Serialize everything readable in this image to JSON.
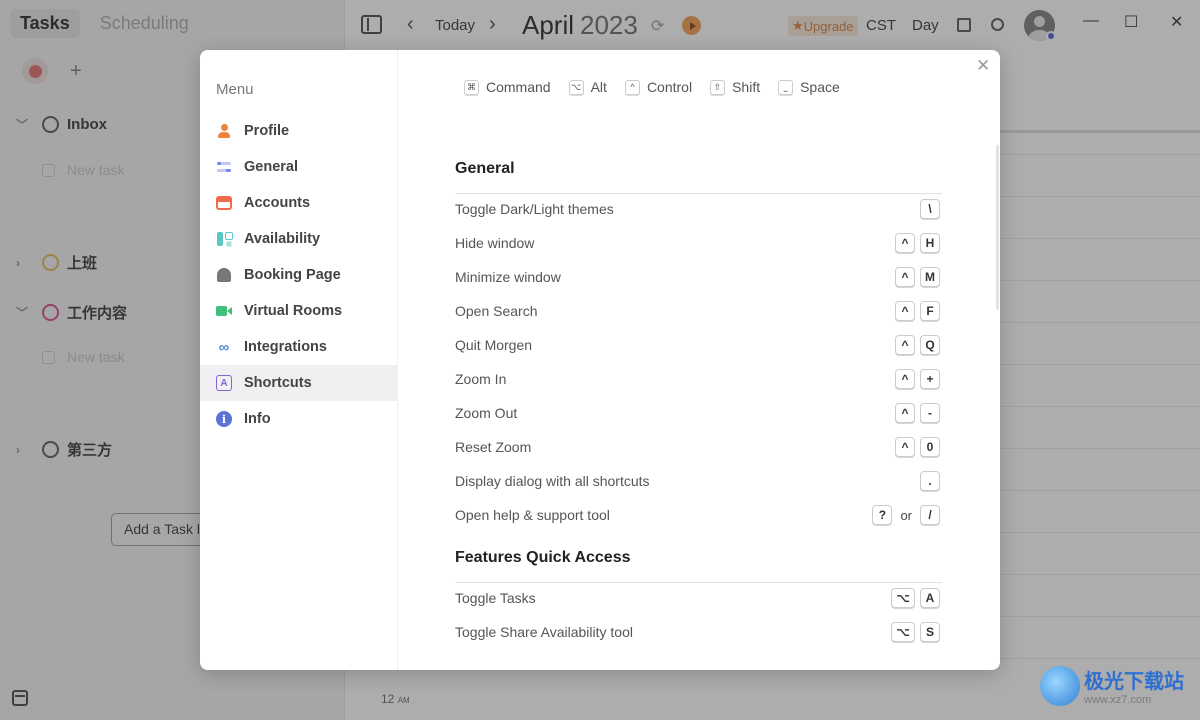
{
  "sidebar": {
    "tabs": [
      "Tasks",
      "Scheduling"
    ],
    "groups": [
      {
        "name": "Inbox",
        "expanded": true,
        "circle_color": "#555555"
      },
      {
        "name": "上班",
        "expanded": false,
        "circle_color": "#e0b850"
      },
      {
        "name": "工作内容",
        "expanded": true,
        "circle_color": "#d64a8a"
      },
      {
        "name": "第三方",
        "expanded": false,
        "circle_color": "#555555"
      }
    ],
    "new_task_placeholder": "New task",
    "add_task_button": "Add a Task li"
  },
  "header": {
    "today": "Today",
    "month": "April",
    "year": "2023",
    "upgrade": "Upgrade",
    "timezone": "CST",
    "view": "Day",
    "window_controls": [
      "—",
      "☐",
      "✕"
    ]
  },
  "calendar": {
    "time_label": "12",
    "time_suffix": "AM"
  },
  "settings_menu": {
    "title": "Menu",
    "items": [
      {
        "label": "Profile",
        "icon": "profile-icon"
      },
      {
        "label": "General",
        "icon": "general-icon"
      },
      {
        "label": "Accounts",
        "icon": "accounts-icon"
      },
      {
        "label": "Availability",
        "icon": "availability-icon"
      },
      {
        "label": "Booking Page",
        "icon": "booking-page-icon"
      },
      {
        "label": "Virtual Rooms",
        "icon": "virtual-rooms-icon"
      },
      {
        "label": "Integrations",
        "icon": "integrations-icon"
      },
      {
        "label": "Shortcuts",
        "icon": "shortcuts-icon",
        "active": true
      },
      {
        "label": "Info",
        "icon": "info-icon"
      }
    ]
  },
  "legend": [
    {
      "key": "⌘",
      "label": "Command"
    },
    {
      "key": "⌥",
      "label": "Alt"
    },
    {
      "key": "^",
      "label": "Control"
    },
    {
      "key": "⇧",
      "label": "Shift"
    },
    {
      "key": "⎵",
      "label": "Space"
    }
  ],
  "sections": [
    {
      "title": "General",
      "shortcuts": [
        {
          "label": "Toggle Dark/Light themes",
          "keys": [
            "\\"
          ]
        },
        {
          "label": "Hide window",
          "keys": [
            "^",
            "H"
          ]
        },
        {
          "label": "Minimize window",
          "keys": [
            "^",
            "M"
          ]
        },
        {
          "label": "Open Search",
          "keys": [
            "^",
            "F"
          ]
        },
        {
          "label": "Quit Morgen",
          "keys": [
            "^",
            "Q"
          ]
        },
        {
          "label": "Zoom In",
          "keys": [
            "^",
            "+"
          ]
        },
        {
          "label": "Zoom Out",
          "keys": [
            "^",
            "-"
          ]
        },
        {
          "label": "Reset Zoom",
          "keys": [
            "^",
            "0"
          ]
        },
        {
          "label": "Display dialog with all shortcuts",
          "keys": [
            "."
          ]
        },
        {
          "label": "Open help & support tool",
          "keys": [
            "?",
            "or",
            "/"
          ]
        }
      ]
    },
    {
      "title": "Features Quick Access",
      "shortcuts": [
        {
          "label": "Toggle Tasks",
          "keys": [
            "⌥",
            "A"
          ]
        },
        {
          "label": "Toggle Share Availability tool",
          "keys": [
            "⌥",
            "S"
          ]
        }
      ]
    }
  ],
  "watermark": {
    "name": "极光下载站",
    "url": "www.xz7.com"
  }
}
